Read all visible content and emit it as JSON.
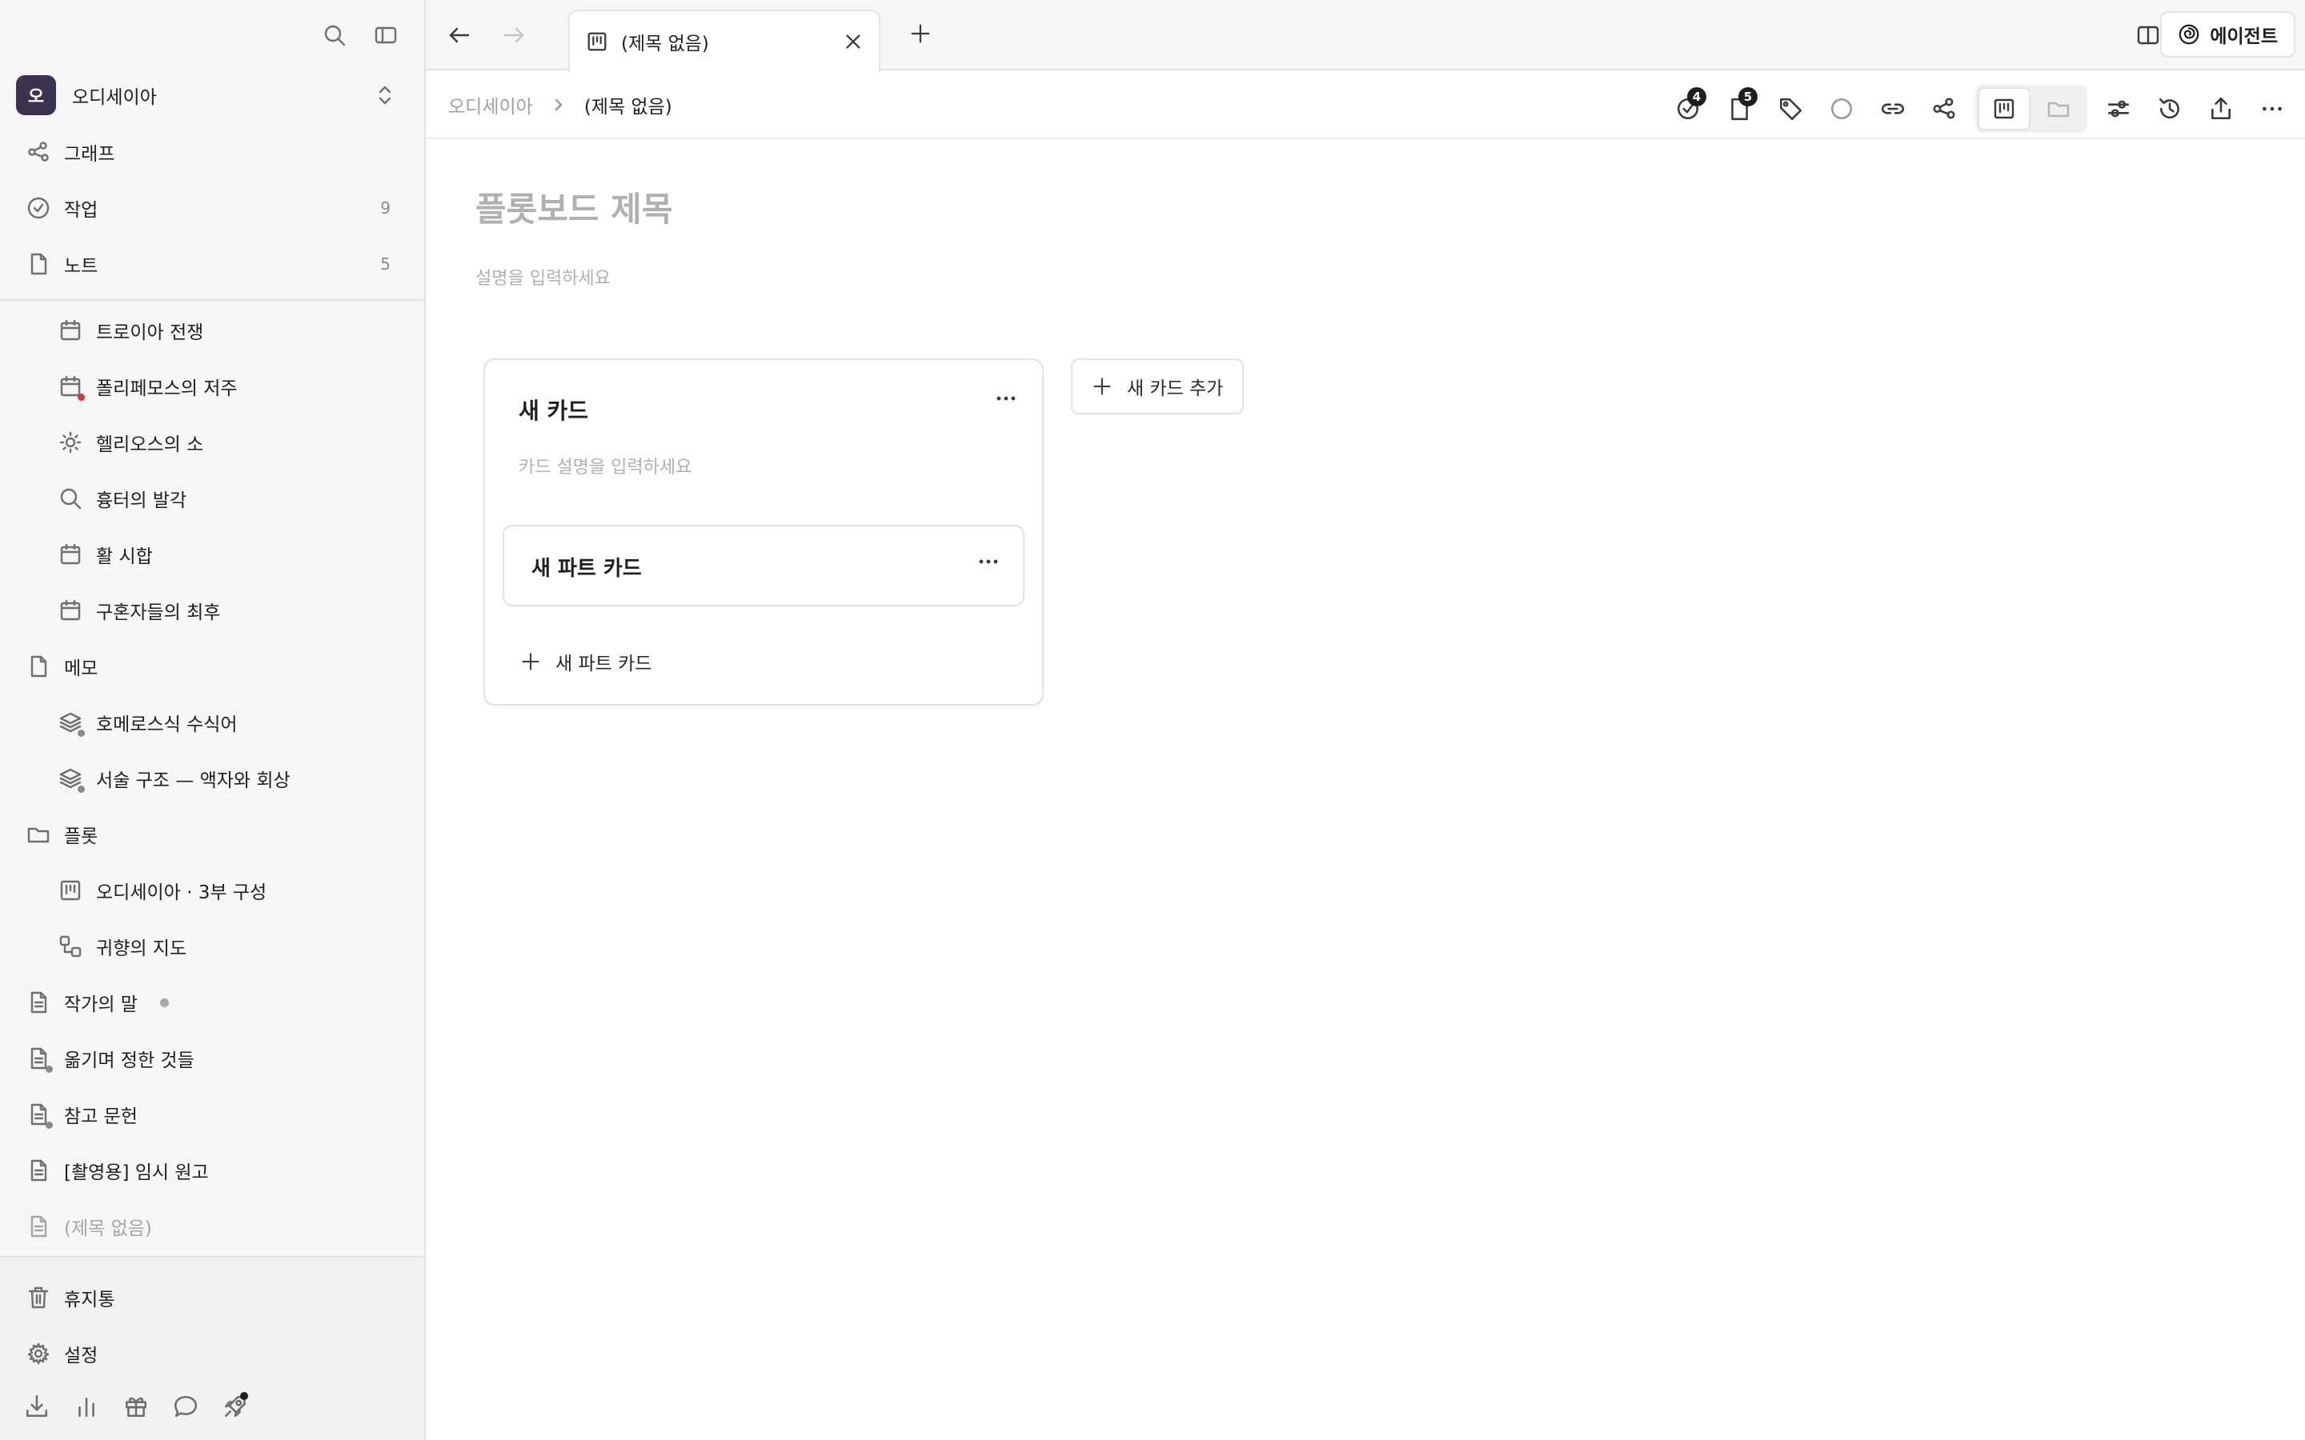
{
  "sidebar": {
    "workspace": {
      "initial": "오",
      "name": "오디세이아"
    },
    "primary": [
      {
        "label": "그래프",
        "icon": "graph-icon",
        "count": ""
      },
      {
        "label": "작업",
        "icon": "check-circle-icon",
        "count": "9"
      },
      {
        "label": "노트",
        "icon": "document-icon",
        "count": "5"
      }
    ],
    "tree": [
      {
        "label": "트로이아 전쟁",
        "icon": "calendar-icon"
      },
      {
        "label": "폴리페모스의 저주",
        "icon": "calendar-icon"
      },
      {
        "label": "헬리오스의 소",
        "icon": "sun-icon"
      },
      {
        "label": "흉터의 발각",
        "icon": "search-icon"
      },
      {
        "label": "활 시합",
        "icon": "calendar-icon"
      },
      {
        "label": "구혼자들의 최후",
        "icon": "calendar-icon"
      },
      {
        "label": "메모",
        "icon": "document-icon"
      },
      {
        "label": "호메로스식 수식어",
        "icon": "layers-icon"
      },
      {
        "label": "서술 구조 — 액자와 회상",
        "icon": "layers-icon"
      },
      {
        "label": "플롯",
        "icon": "folder-icon"
      },
      {
        "label": "오디세이아 · 3부 구성",
        "icon": "kanban-icon"
      },
      {
        "label": "귀향의 지도",
        "icon": "diagram-icon"
      },
      {
        "label": "작가의 말",
        "icon": "file-text-icon"
      },
      {
        "label": "옮기며 정한 것들",
        "icon": "file-text-icon"
      },
      {
        "label": "참고 문헌",
        "icon": "file-text-icon"
      },
      {
        "label": "[촬영용] 임시 원고",
        "icon": "file-text-icon"
      },
      {
        "label": "(제목 없음)",
        "icon": "file-text-icon"
      }
    ],
    "footer": [
      {
        "label": "휴지통",
        "icon": "trash-icon"
      },
      {
        "label": "설정",
        "icon": "gear-icon"
      }
    ]
  },
  "tabbar": {
    "tab_label": "(제목 없음)",
    "agent_label": "에이전트"
  },
  "toolbar": {
    "breadcrumb_root": "오디세이아",
    "breadcrumb_current": "(제목 없음)",
    "task_count": "4",
    "note_count": "5"
  },
  "board": {
    "title_placeholder": "플롯보드 제목",
    "desc_placeholder": "설명을 입력하세요",
    "card": {
      "title": "새 카드",
      "desc_placeholder": "카드 설명을 입력하세요",
      "part_title": "새 파트 카드",
      "add_part_label": "새 파트 카드"
    },
    "add_card_label": "새 카드 추가"
  },
  "colors": {
    "accent": "#3b3350",
    "badge": "#1f1f1f",
    "alert_dot": "#d8343a"
  }
}
